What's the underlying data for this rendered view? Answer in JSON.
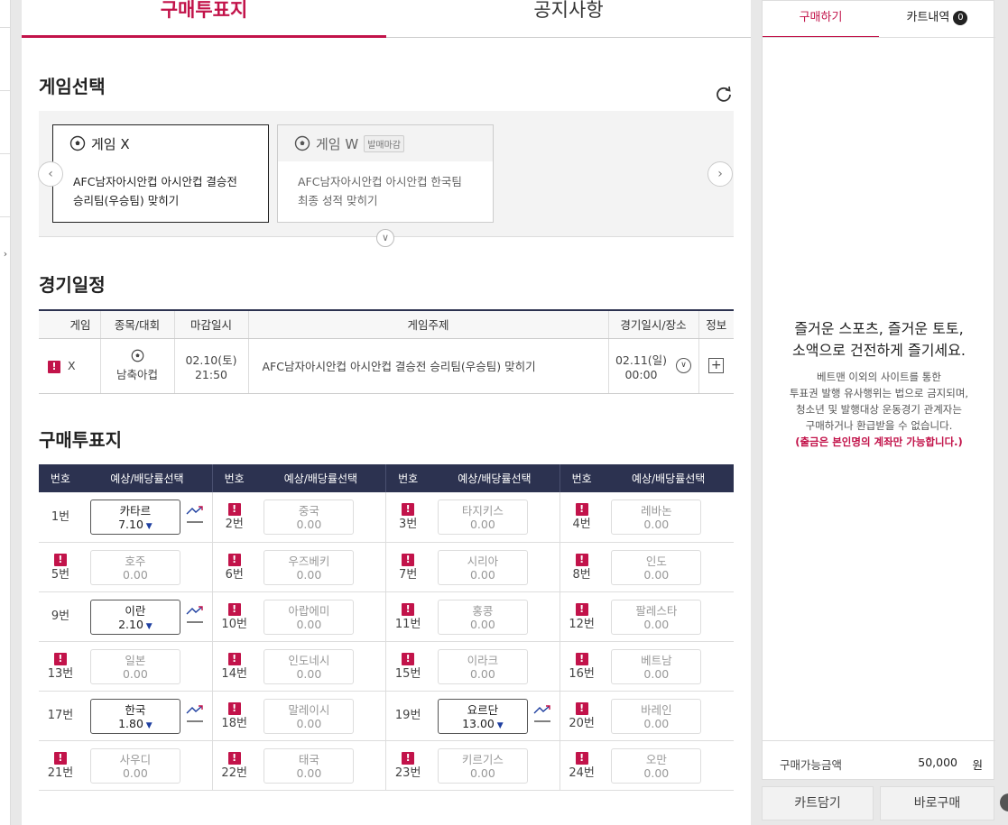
{
  "tabs": [
    "구매투표지",
    "공지사항"
  ],
  "game_select": {
    "title": "게임선택",
    "games": [
      {
        "name": "게임 X",
        "badge": "",
        "desc1": "AFC남자아시안컵 아시안컵 결승전",
        "desc2": "승리팀(우승팀) 맞히기"
      },
      {
        "name": "게임 W",
        "badge": "발매마감",
        "desc1": "AFC남자아시안컵 아시안컵 한국팀",
        "desc2": "최종 성적 맞히기"
      }
    ]
  },
  "schedule": {
    "title": "경기일정",
    "headers": [
      "게임",
      "종목/대회",
      "마감일시",
      "게임주제",
      "경기일시/장소",
      "정보"
    ],
    "row": {
      "game": "X",
      "sport": "남축아컵",
      "deadline_date": "02.10(토)",
      "deadline_time": "21:50",
      "topic": "AFC남자아시안컵 아시안컵 결승전 승리팀(우승팀) 맞히기",
      "match_date": "02.11(일)",
      "match_time": "00:00"
    }
  },
  "slip": {
    "title": "구매투표지",
    "col_num": "번호",
    "col_pick": "예상/배당률선택",
    "rows": [
      [
        {
          "num": "1번",
          "team": "카타르",
          "odds": "7.10",
          "active": true
        },
        {
          "num": "2번",
          "team": "중국",
          "odds": "0.00",
          "active": false
        },
        {
          "num": "3번",
          "team": "타지키스",
          "odds": "0.00",
          "active": false
        },
        {
          "num": "4번",
          "team": "레바논",
          "odds": "0.00",
          "active": false
        }
      ],
      [
        {
          "num": "5번",
          "team": "호주",
          "odds": "0.00",
          "active": false
        },
        {
          "num": "6번",
          "team": "우즈베키",
          "odds": "0.00",
          "active": false
        },
        {
          "num": "7번",
          "team": "시리아",
          "odds": "0.00",
          "active": false
        },
        {
          "num": "8번",
          "team": "인도",
          "odds": "0.00",
          "active": false
        }
      ],
      [
        {
          "num": "9번",
          "team": "이란",
          "odds": "2.10",
          "active": true
        },
        {
          "num": "10번",
          "team": "아랍에미",
          "odds": "0.00",
          "active": false
        },
        {
          "num": "11번",
          "team": "홍콩",
          "odds": "0.00",
          "active": false
        },
        {
          "num": "12번",
          "team": "팔레스타",
          "odds": "0.00",
          "active": false
        }
      ],
      [
        {
          "num": "13번",
          "team": "일본",
          "odds": "0.00",
          "active": false
        },
        {
          "num": "14번",
          "team": "인도네시",
          "odds": "0.00",
          "active": false
        },
        {
          "num": "15번",
          "team": "이라크",
          "odds": "0.00",
          "active": false
        },
        {
          "num": "16번",
          "team": "베트남",
          "odds": "0.00",
          "active": false
        }
      ],
      [
        {
          "num": "17번",
          "team": "한국",
          "odds": "1.80",
          "active": true
        },
        {
          "num": "18번",
          "team": "말레이시",
          "odds": "0.00",
          "active": false
        },
        {
          "num": "19번",
          "team": "요르단",
          "odds": "13.00",
          "active": true
        },
        {
          "num": "20번",
          "team": "바레인",
          "odds": "0.00",
          "active": false
        }
      ],
      [
        {
          "num": "21번",
          "team": "사우디",
          "odds": "0.00",
          "active": false
        },
        {
          "num": "22번",
          "team": "태국",
          "odds": "0.00",
          "active": false
        },
        {
          "num": "23번",
          "team": "키르기스",
          "odds": "0.00",
          "active": false
        },
        {
          "num": "24번",
          "team": "오만",
          "odds": "0.00",
          "active": false
        }
      ]
    ]
  },
  "sidebar": {
    "tab_buy": "구매하기",
    "tab_cart": "카트내역",
    "cart_count": "0",
    "msg_line1": "즐거운 스포츠, 즐거운 토토,",
    "msg_line2": "소액으로 건전하게 즐기세요.",
    "warn_lines": [
      "베트맨 이외의 사이트를 통한",
      "투표권 발행 유사행위는 법으로 금지되며,",
      "청소년 및 발행대상 운동경기 관계자는",
      "구매하거나 환급받을 수 없습니다."
    ],
    "warn_red": "(출금은 본인명의 계좌만 가능합니다.)",
    "amount_label": "구매가능금액",
    "amount_value": "50,000",
    "amount_unit": "원",
    "btn_cart": "카트담기",
    "btn_buy": "바로구매"
  },
  "colors": {
    "accent": "#c2134a",
    "navy": "#2c3250"
  }
}
